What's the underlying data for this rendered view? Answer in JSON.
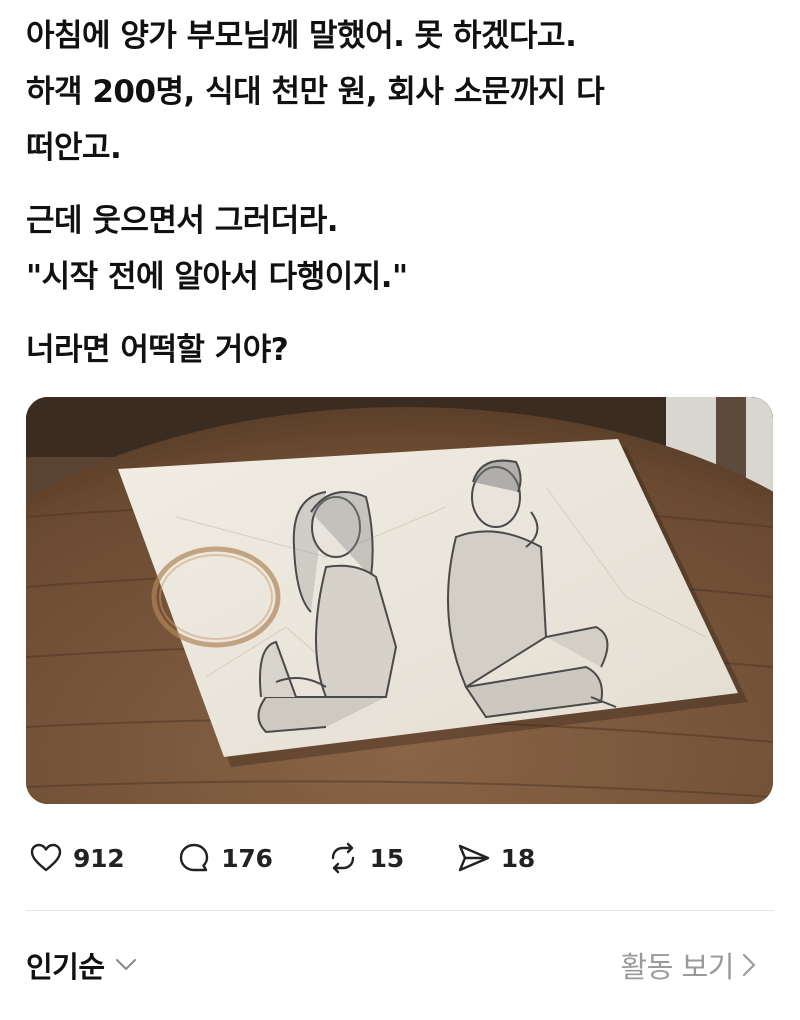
{
  "post": {
    "paragraphs": [
      [
        "아침에 양가 부모님께 말했어. 못 하겠다고.",
        "하객 200명, 식대 천만 원, 회사 소문까지 다",
        "떠안고."
      ],
      [
        "근데 웃으면서 그러더라.",
        "\"시작 전에 알아서 다행이지.\""
      ],
      [
        "너라면 어떡할 거야?"
      ]
    ]
  },
  "actions": {
    "like": {
      "icon": "heart-icon",
      "count": "912"
    },
    "comment": {
      "icon": "comment-bubble-icon",
      "count": "176"
    },
    "repost": {
      "icon": "repost-icon",
      "count": "15"
    },
    "share": {
      "icon": "send-icon",
      "count": "18"
    }
  },
  "footer": {
    "sort_label": "인기순",
    "sort_icon": "chevron-down-icon",
    "activity_label": "활동 보기",
    "activity_icon": "chevron-right-icon"
  },
  "colors": {
    "text": "#111111",
    "muted": "#9a9a9a",
    "divider": "#e6e6e6"
  }
}
